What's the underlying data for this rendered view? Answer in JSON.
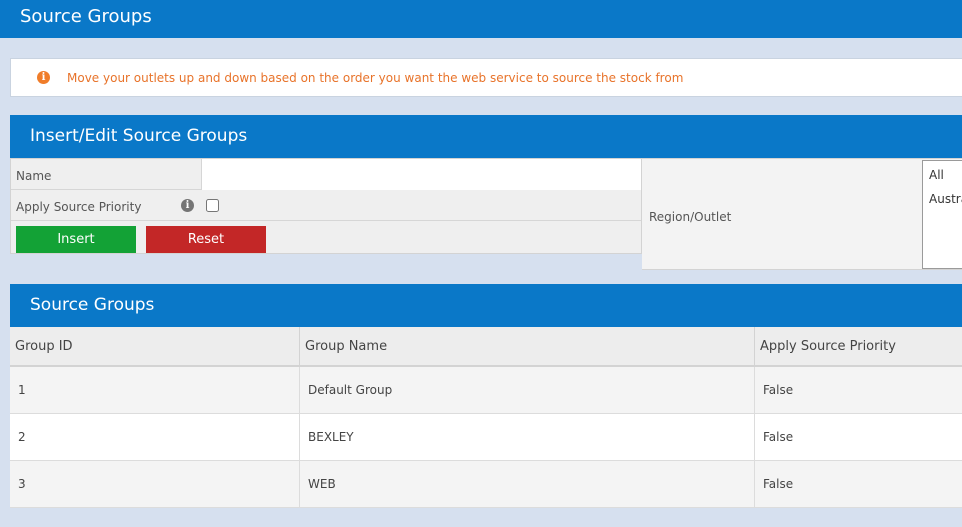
{
  "page": {
    "title": "Source Groups"
  },
  "notice": {
    "text": "Move your outlets up and down based on the order you want the web service to source the stock from"
  },
  "form": {
    "title": "Insert/Edit Source Groups",
    "name_label": "Name",
    "name_value": "",
    "priority_label": "Apply Source Priority",
    "priority_checked": false,
    "insert_label": "Insert",
    "reset_label": "Reset",
    "region_label": "Region/Outlet",
    "region_options": [
      "All",
      "Austra"
    ]
  },
  "groups": {
    "title": "Source Groups",
    "columns": [
      "Group ID",
      "Group Name",
      "Apply Source Priority"
    ],
    "rows": [
      {
        "id": "1",
        "name": "Default Group",
        "priority": "False"
      },
      {
        "id": "2",
        "name": "BEXLEY",
        "priority": "False"
      },
      {
        "id": "3",
        "name": "WEB",
        "priority": "False"
      }
    ]
  },
  "colors": {
    "header_blue": "#0a78c8",
    "background": "#d6e0ef",
    "notice_orange": "#e8732a",
    "insert_green": "#13a236",
    "reset_red": "#c32727"
  }
}
